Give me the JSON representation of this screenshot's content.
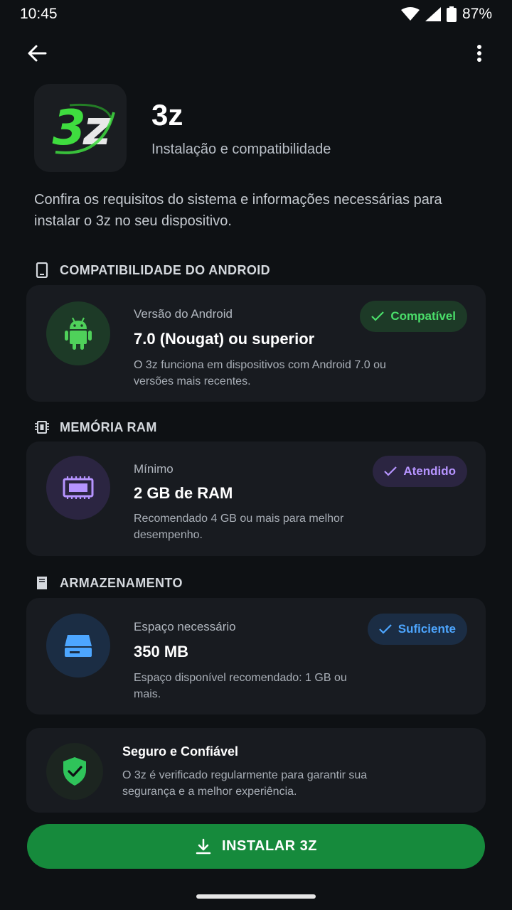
{
  "status": {
    "time": "10:45",
    "battery": "87%"
  },
  "app": {
    "name": "3z",
    "subtitle": "Instalação e compatibilidade",
    "icon_text_a": "3",
    "icon_text_b": "z"
  },
  "intro": "Confira os requisitos do sistema e informações necessárias para instalar o 3z no seu dispositivo.",
  "sections": {
    "android": {
      "title": "COMPATIBILIDADE DO ANDROID",
      "label": "Versão do Android",
      "value": "7.0 (Nougat) ou superior",
      "desc": "O 3z funciona em dispositivos com Android 7.0 ou versões mais recentes.",
      "badge": "Compatível"
    },
    "ram": {
      "title": "MEMÓRIA RAM",
      "label": "Mínimo",
      "value": "2 GB de RAM",
      "desc": "Recomendado 4 GB ou mais para melhor desempenho.",
      "badge": "Atendido"
    },
    "storage": {
      "title": "ARMAZENAMENTO",
      "label": "Espaço necessário",
      "value": "350 MB",
      "desc": "Espaço disponível recomendado: 1 GB ou mais.",
      "badge": "Suficiente"
    }
  },
  "security": {
    "title": "Seguro e Confiável",
    "desc": "O 3z é verificado regularmente para garantir sua segurança e a melhor experiência."
  },
  "install_button": "INSTALAR 3Z",
  "colors": {
    "background": "#0e1114",
    "card": "#181b20",
    "green": "#168a3c",
    "green_badge": "#4ade6a",
    "purple_badge": "#b694ff",
    "blue_badge": "#4da6ff"
  }
}
